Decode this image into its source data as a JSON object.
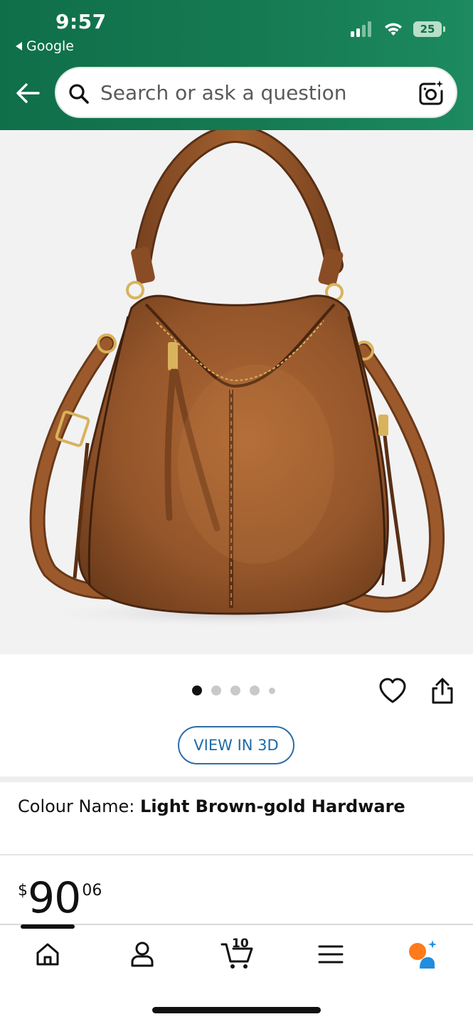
{
  "status_bar": {
    "time": "9:57",
    "back_app": "Google",
    "battery": "25"
  },
  "search": {
    "placeholder": "Search or ask a question"
  },
  "product": {
    "image_alt": "Brown leather hobo shoulder bag with gold hardware",
    "carousel_dots": 5,
    "carousel_active_index": 0,
    "view_3d_label": "VIEW IN 3D",
    "colour_label": "Colour Name:",
    "colour_value": "Light Brown-gold Hardware",
    "price": {
      "symbol": "$",
      "whole": "90",
      "fraction": "06"
    }
  },
  "bottom_nav": {
    "items": [
      "home",
      "account",
      "cart",
      "menu",
      "rufus"
    ],
    "active": "home",
    "cart_count": "10"
  },
  "colors": {
    "header_green": "#157a52",
    "accent_blue": "#1e6aa6",
    "bag_brown": "#9a5a2c"
  }
}
